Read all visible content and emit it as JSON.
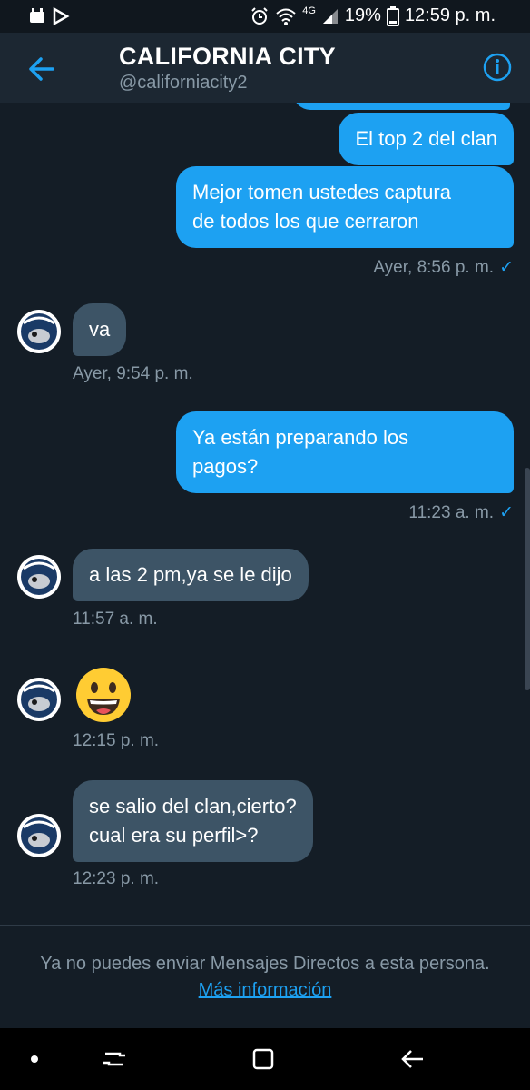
{
  "status_bar": {
    "battery": "19%",
    "time": "12:59 p. m.",
    "network": "4G"
  },
  "header": {
    "title": "CALIFORNIA CITY",
    "handle": "@californiacity2"
  },
  "messages": [
    {
      "direction": "out",
      "text": "El top 2 del clan"
    },
    {
      "direction": "out",
      "text": "Mejor tomen ustedes captura\nde todos los que cerraron",
      "time": "Ayer, 8:56 p. m."
    },
    {
      "direction": "in",
      "text": "va",
      "time": "Ayer, 9:54 p. m."
    },
    {
      "direction": "out",
      "text": "Ya están preparando los\npagos?",
      "time": "11:23 a. m."
    },
    {
      "direction": "in",
      "text": "a las 2 pm,ya se le dijo",
      "time": "11:57 a. m."
    },
    {
      "direction": "in",
      "emoji": "grinning-face",
      "time": "12:15 p. m."
    },
    {
      "direction": "in",
      "text": "se salio del clan,cierto?\ncual era su perfil>?",
      "time": "12:23 p. m."
    }
  ],
  "footer": {
    "notice": "Ya no puedes enviar Mensajes Directos a esta persona.",
    "link": "Más información"
  },
  "colors": {
    "background": "#141d26",
    "header": "#1c2732",
    "accent": "#1da1f2",
    "incoming_bubble": "#3d5466",
    "secondary_text": "#8899a6"
  },
  "nav_icons": [
    "dot-icon",
    "recent-apps-icon",
    "home-icon",
    "back-icon"
  ]
}
